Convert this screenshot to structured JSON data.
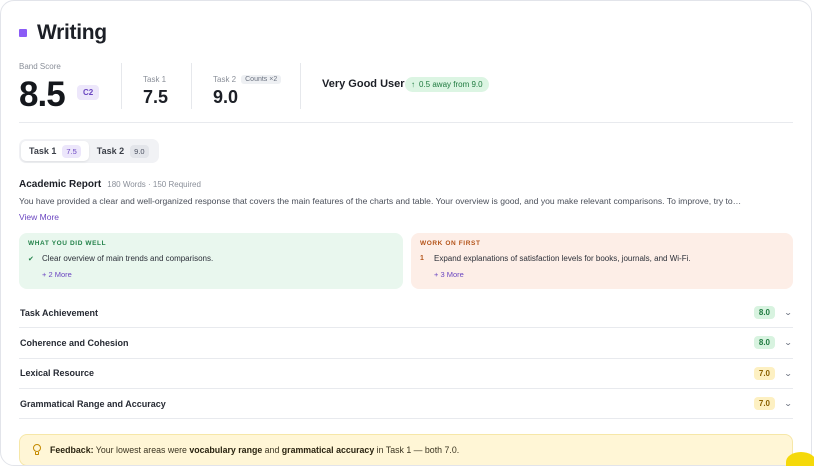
{
  "header": {
    "title": "Writing"
  },
  "score": {
    "band_label": "Band Score",
    "band_value": "8.5",
    "cefr": "C2",
    "task1_label": "Task 1",
    "task1_value": "7.5",
    "task2_label": "Task 2",
    "task2_counts": "Counts ×2",
    "task2_value": "9.0",
    "level": "Very Good User",
    "away": "0.5 away from 9.0"
  },
  "tabs": [
    {
      "label": "Task 1",
      "score": "7.5",
      "active": true
    },
    {
      "label": "Task 2",
      "score": "9.0",
      "active": false
    }
  ],
  "report": {
    "title": "Academic Report",
    "meta": "180 Words · 150 Required",
    "summary": "You have provided a clear and well-organized response that covers the main features of the charts and table. Your overview is good, and you make relevant comparisons. To improve, try to…",
    "view_more": "View More"
  },
  "strengths": {
    "title": "WHAT YOU DID WELL",
    "items": [
      "Clear overview of main trends and comparisons."
    ],
    "more": "+ 2 More"
  },
  "work_on": {
    "title": "WORK ON FIRST",
    "items": [
      {
        "num": "1",
        "text": "Expand explanations of satisfaction levels for books, journals, and Wi-Fi."
      }
    ],
    "more": "+ 3 More"
  },
  "criteria": [
    {
      "name": "Task Achievement",
      "score": "8.0",
      "tone": "green"
    },
    {
      "name": "Coherence and Cohesion",
      "score": "8.0",
      "tone": "green"
    },
    {
      "name": "Lexical Resource",
      "score": "7.0",
      "tone": "yellow"
    },
    {
      "name": "Grammatical Range and Accuracy",
      "score": "7.0",
      "tone": "yellow"
    }
  ],
  "feedback": {
    "label": "Feedback:",
    "text1": " Your lowest areas were ",
    "bold1": "vocabulary range",
    "text2": " and ",
    "bold2": "grammatical accuracy",
    "text3": " in Task 1 — both 7.0."
  },
  "colors": {
    "accent": "#8b5cf6",
    "good": "#23824a",
    "warn": "#b4541a"
  },
  "icons": {
    "away": "arrow-up-icon",
    "check": "check-icon",
    "chevron": "chevron-down-icon",
    "feedback": "lightbulb-icon"
  }
}
